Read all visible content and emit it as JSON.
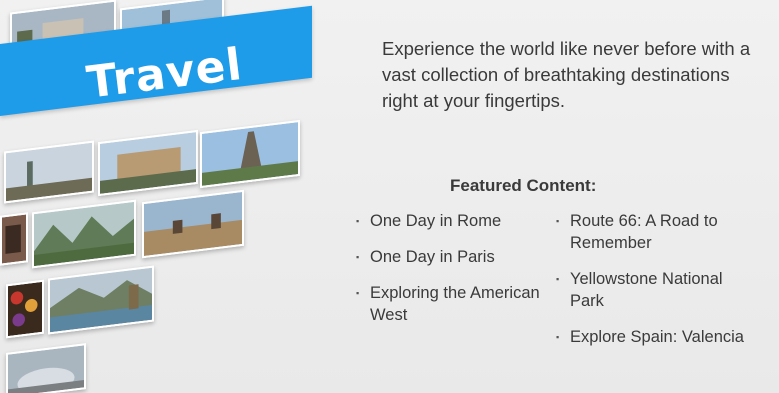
{
  "banner": {
    "title": "Travel"
  },
  "tagline": "Experience the world like never before with a vast collection of breathtaking destinations right at your fingertips.",
  "featured": {
    "heading": "Featured Content:",
    "left": [
      "One Day in Rome",
      "One Day in Paris",
      "Exploring the American West"
    ],
    "right": [
      "Route 66: A Road to Remember",
      "Yellowstone National Park",
      "Explore Spain: Valencia"
    ]
  },
  "colors": {
    "banner": "#1e9be9",
    "text": "#3a3a3a",
    "background": "#eeeeee"
  }
}
